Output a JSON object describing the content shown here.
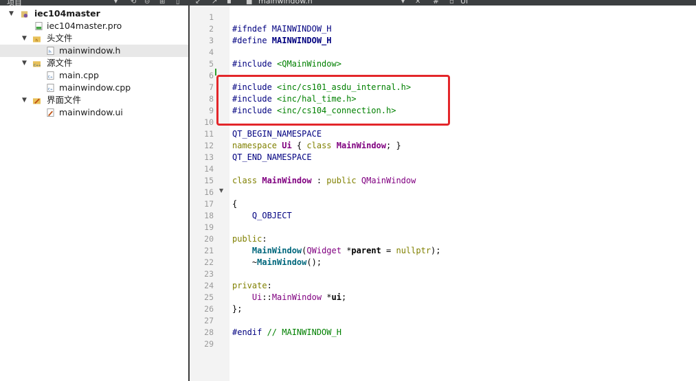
{
  "topbar": {
    "panel_title": "项目",
    "file_tab": "mainwindow.h",
    "symbol": "#",
    "symbol_tab": "Ui"
  },
  "project_tree": {
    "root": "iec104master",
    "pro_file": "iec104master.pro",
    "headers_folder": "头文件",
    "header_file": "mainwindow.h",
    "sources_folder": "源文件",
    "source_files": [
      "main.cpp",
      "mainwindow.cpp"
    ],
    "forms_folder": "界面文件",
    "form_file": "mainwindow.ui"
  },
  "editor": {
    "line_numbers": [
      "1",
      "2",
      "3",
      "4",
      "5",
      "6",
      "7",
      "8",
      "9",
      "10",
      "11",
      "12",
      "13",
      "14",
      "15",
      "16",
      "17",
      "18",
      "19",
      "20",
      "21",
      "22",
      "23",
      "24",
      "25",
      "26",
      "27",
      "28",
      "29"
    ],
    "lines": {
      "l2_a": "#ifndef ",
      "l2_b": "MAINWINDOW_H",
      "l3_a": "#define ",
      "l3_b": "MAINWINDOW_H",
      "l5_a": "#include ",
      "l5_b": "<QMainWindow>",
      "l7_a": "#include ",
      "l7_b": "<inc/cs101_asdu_internal.h>",
      "l8_a": "#include ",
      "l8_b": "<inc/hal_time.h>",
      "l9_a": "#include ",
      "l9_b": "<inc/cs104_connection.h>",
      "l11": "QT_BEGIN_NAMESPACE",
      "l12_a": "namespace ",
      "l12_b": "Ui",
      "l12_c": " { ",
      "l12_d": "class ",
      "l12_e": "MainWindow",
      "l12_f": "; }",
      "l13": "QT_END_NAMESPACE",
      "l15_a": "class ",
      "l15_b": "MainWindow",
      "l15_c": " : ",
      "l15_d": "public ",
      "l15_e": "QMainWindow",
      "l17": "{",
      "l18": "    Q_OBJECT",
      "l20_a": "public",
      "l20_b": ":",
      "l21_a": "    ",
      "l21_b": "MainWindow",
      "l21_c": "(",
      "l21_d": "QWidget",
      "l21_e": " *",
      "l21_f": "parent",
      "l21_g": " = ",
      "l21_h": "nullptr",
      "l21_i": ");",
      "l22_a": "    ~",
      "l22_b": "MainWindow",
      "l22_c": "();",
      "l24_a": "private",
      "l24_b": ":",
      "l25_a": "    ",
      "l25_b": "Ui",
      "l25_c": "::",
      "l25_d": "MainWindow",
      "l25_e": " *",
      "l25_f": "ui",
      "l25_g": ";",
      "l26": "};",
      "l28_a": "#endif",
      "l28_b": " // MAINWINDOW_H"
    }
  },
  "colors": {
    "highlight_box": "#e3262a",
    "keyword": "#808000",
    "type": "#800080",
    "preprocessor": "#000080",
    "include_path": "#008000"
  }
}
